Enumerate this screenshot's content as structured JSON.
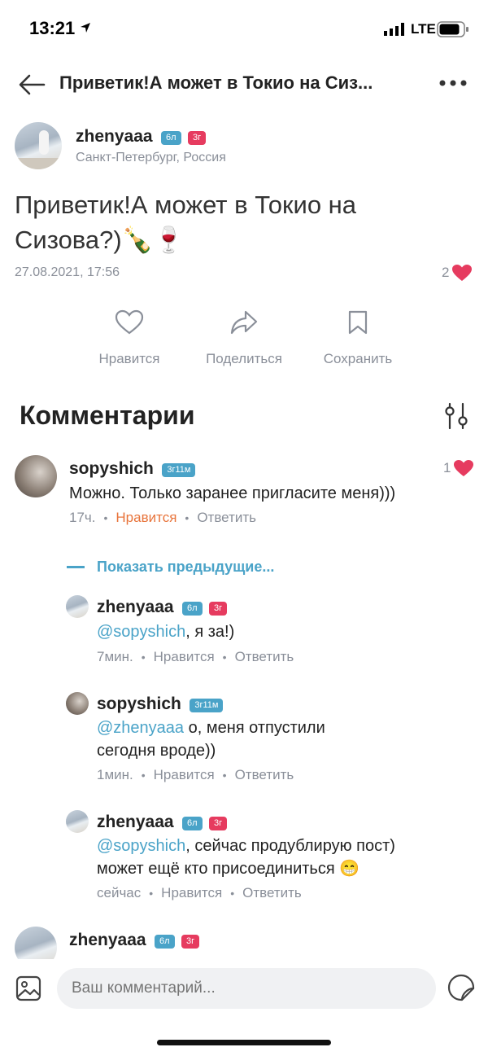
{
  "status_bar": {
    "time": "13:21",
    "network": "LTE"
  },
  "header": {
    "title": "Приветик!А может в Токио на Сиз..."
  },
  "post": {
    "author": "zhenyaaa",
    "badges": [
      "6л",
      "3г"
    ],
    "location": "Санкт-Петербург, Россия",
    "text": "Приветик!А может в Токио на Сизова?)🍾🍷",
    "date": "27.08.2021, 17:56",
    "likes": "2"
  },
  "actions": {
    "like": "Нравится",
    "share": "Поделиться",
    "save": "Сохранить"
  },
  "comments_section": {
    "title": "Комментарии"
  },
  "comments": [
    {
      "author": "sopyshich",
      "badge": "3г11м",
      "text": "Можно. Только заранее пригласите меня)))",
      "time": "17ч.",
      "like": "Нравится",
      "reply": "Ответить",
      "likes": "1"
    }
  ],
  "show_previous": "Показать предыдущие...",
  "replies": [
    {
      "author": "zhenyaaa",
      "badges": [
        "6л",
        "3г"
      ],
      "mention": "@sopyshich",
      "text": ", я за!)",
      "time": "7мин.",
      "like": "Нравится",
      "reply": "Ответить"
    },
    {
      "author": "sopyshich",
      "badge": "3г11м",
      "mention": "@zhenyaaa",
      "text": " о, меня отпустили",
      "text2": "сегодня вроде))",
      "time": "1мин.",
      "like": "Нравится",
      "reply": "Ответить"
    },
    {
      "author": "zhenyaaa",
      "badges": [
        "6л",
        "3г"
      ],
      "mention": "@sopyshich",
      "text": ", сейчас продублирую пост)",
      "text2": "может ещё кто присоединиться 😁",
      "time": "сейчас",
      "like": "Нравится",
      "reply": "Ответить"
    }
  ],
  "partial_comment": {
    "author": "zhenyaaa",
    "badges": [
      "6л",
      "3г"
    ]
  },
  "composer": {
    "placeholder": "Ваш комментарий..."
  },
  "colors": {
    "accent": "#4aa3c8",
    "heart": "#e63b5f",
    "liked": "#e8743b"
  }
}
